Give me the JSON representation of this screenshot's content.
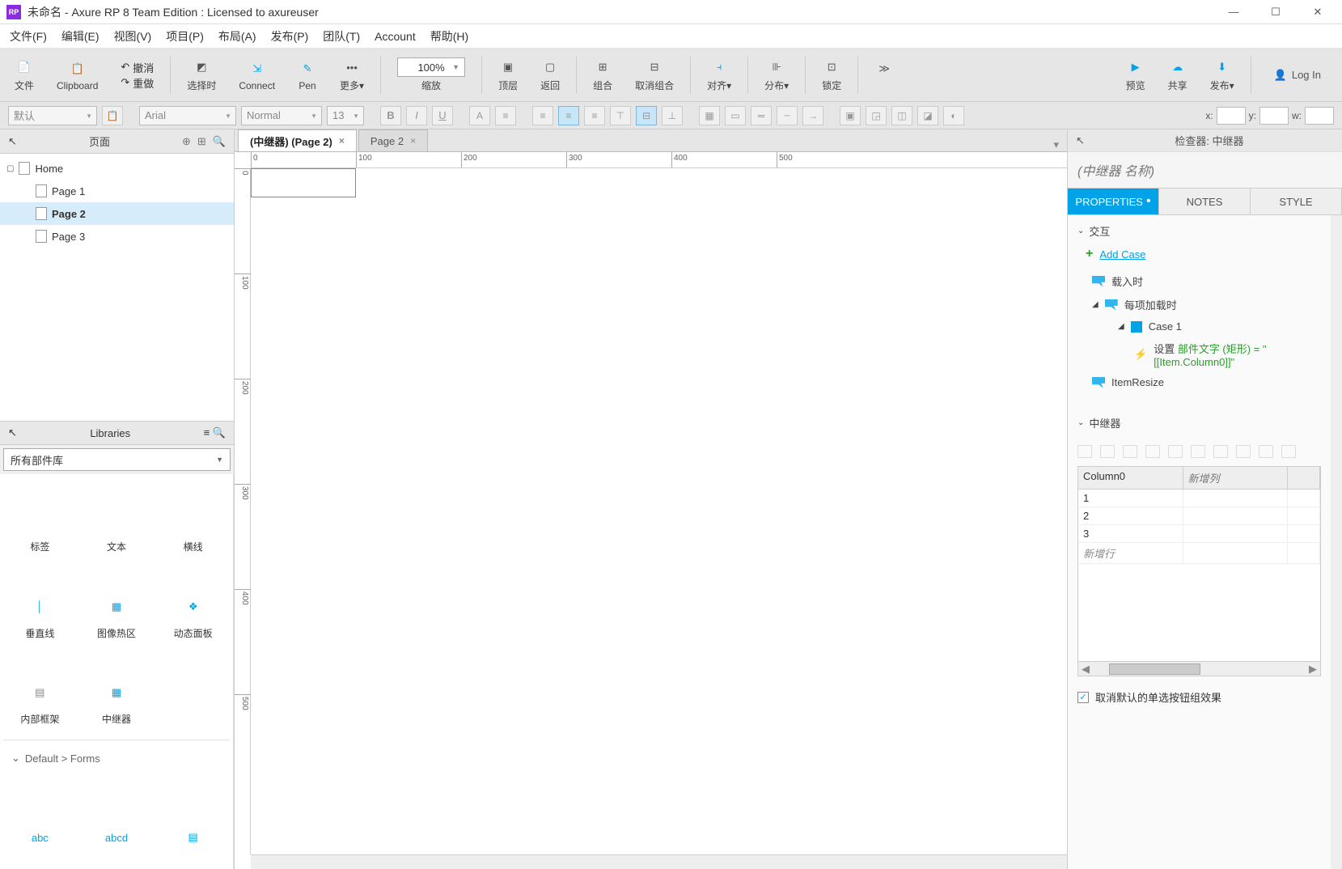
{
  "window": {
    "title": "未命名 - Axure RP 8 Team Edition : Licensed to axureuser"
  },
  "menubar": [
    "文件(F)",
    "编辑(E)",
    "视图(V)",
    "项目(P)",
    "布局(A)",
    "发布(P)",
    "团队(T)",
    "Account",
    "帮助(H)"
  ],
  "toolbar": {
    "file": "文件",
    "clipboard": "Clipboard",
    "undo": "撤消",
    "redo": "重做",
    "select": "选择时",
    "connect": "Connect",
    "pen": "Pen",
    "more": "更多▾",
    "zoom_value": "100%",
    "zoom_label": "缩放",
    "top": "顶层",
    "back": "返回",
    "group": "组合",
    "ungroup": "取消组合",
    "align": "对齐▾",
    "distribute": "分布▾",
    "lock": "锁定",
    "more2": "≫",
    "preview": "预览",
    "share": "共享",
    "publish": "发布▾",
    "login": "Log In"
  },
  "formatbar": {
    "style": "默认",
    "font": "Arial",
    "weight": "Normal",
    "size": "13",
    "x_lbl": "x:",
    "y_lbl": "y:",
    "w_lbl": "w:"
  },
  "pages_panel": {
    "title": "页面",
    "tree": [
      {
        "label": "Home",
        "children": [
          {
            "label": "Page 1"
          },
          {
            "label": "Page 2",
            "selected": true
          },
          {
            "label": "Page 3"
          }
        ]
      }
    ]
  },
  "libraries_panel": {
    "title": "Libraries",
    "selector": "所有部件库",
    "items_row1": [
      "标签",
      "文本",
      "横线"
    ],
    "items_row2": [
      "垂直线",
      "图像热区",
      "动态面板"
    ],
    "items_row3": [
      "内部框架",
      "中继器"
    ],
    "category": "Default > Forms"
  },
  "canvas": {
    "tabs": [
      {
        "label": "(中继器) (Page 2)",
        "active": true
      },
      {
        "label": "Page 2",
        "active": false
      }
    ],
    "ruler_h": [
      0,
      100,
      200,
      300,
      400,
      500
    ],
    "ruler_v": [
      0,
      100,
      200,
      300,
      400,
      500
    ]
  },
  "inspector": {
    "header": "检查器: 中继器",
    "widget_name": "(中继器 名称)",
    "tabs": {
      "properties": "PROPERTIES",
      "notes": "NOTES",
      "style": "STYLE"
    },
    "section_interact": "交互",
    "add_case": "Add Case",
    "events": {
      "onload": "载入时",
      "itemload": "每项加载时",
      "case1": "Case 1",
      "action_prefix": "设置 ",
      "action_green": "部件文字 (矩形) = \"[[Item.Column0]]\"",
      "itemresize": "ItemResize"
    },
    "section_repeater": "中继器",
    "table": {
      "cols": [
        "Column0",
        "新增列"
      ],
      "rows": [
        "1",
        "2",
        "3"
      ],
      "newrow": "新增行"
    },
    "checkbox": "取消默认的单选按钮组效果"
  }
}
